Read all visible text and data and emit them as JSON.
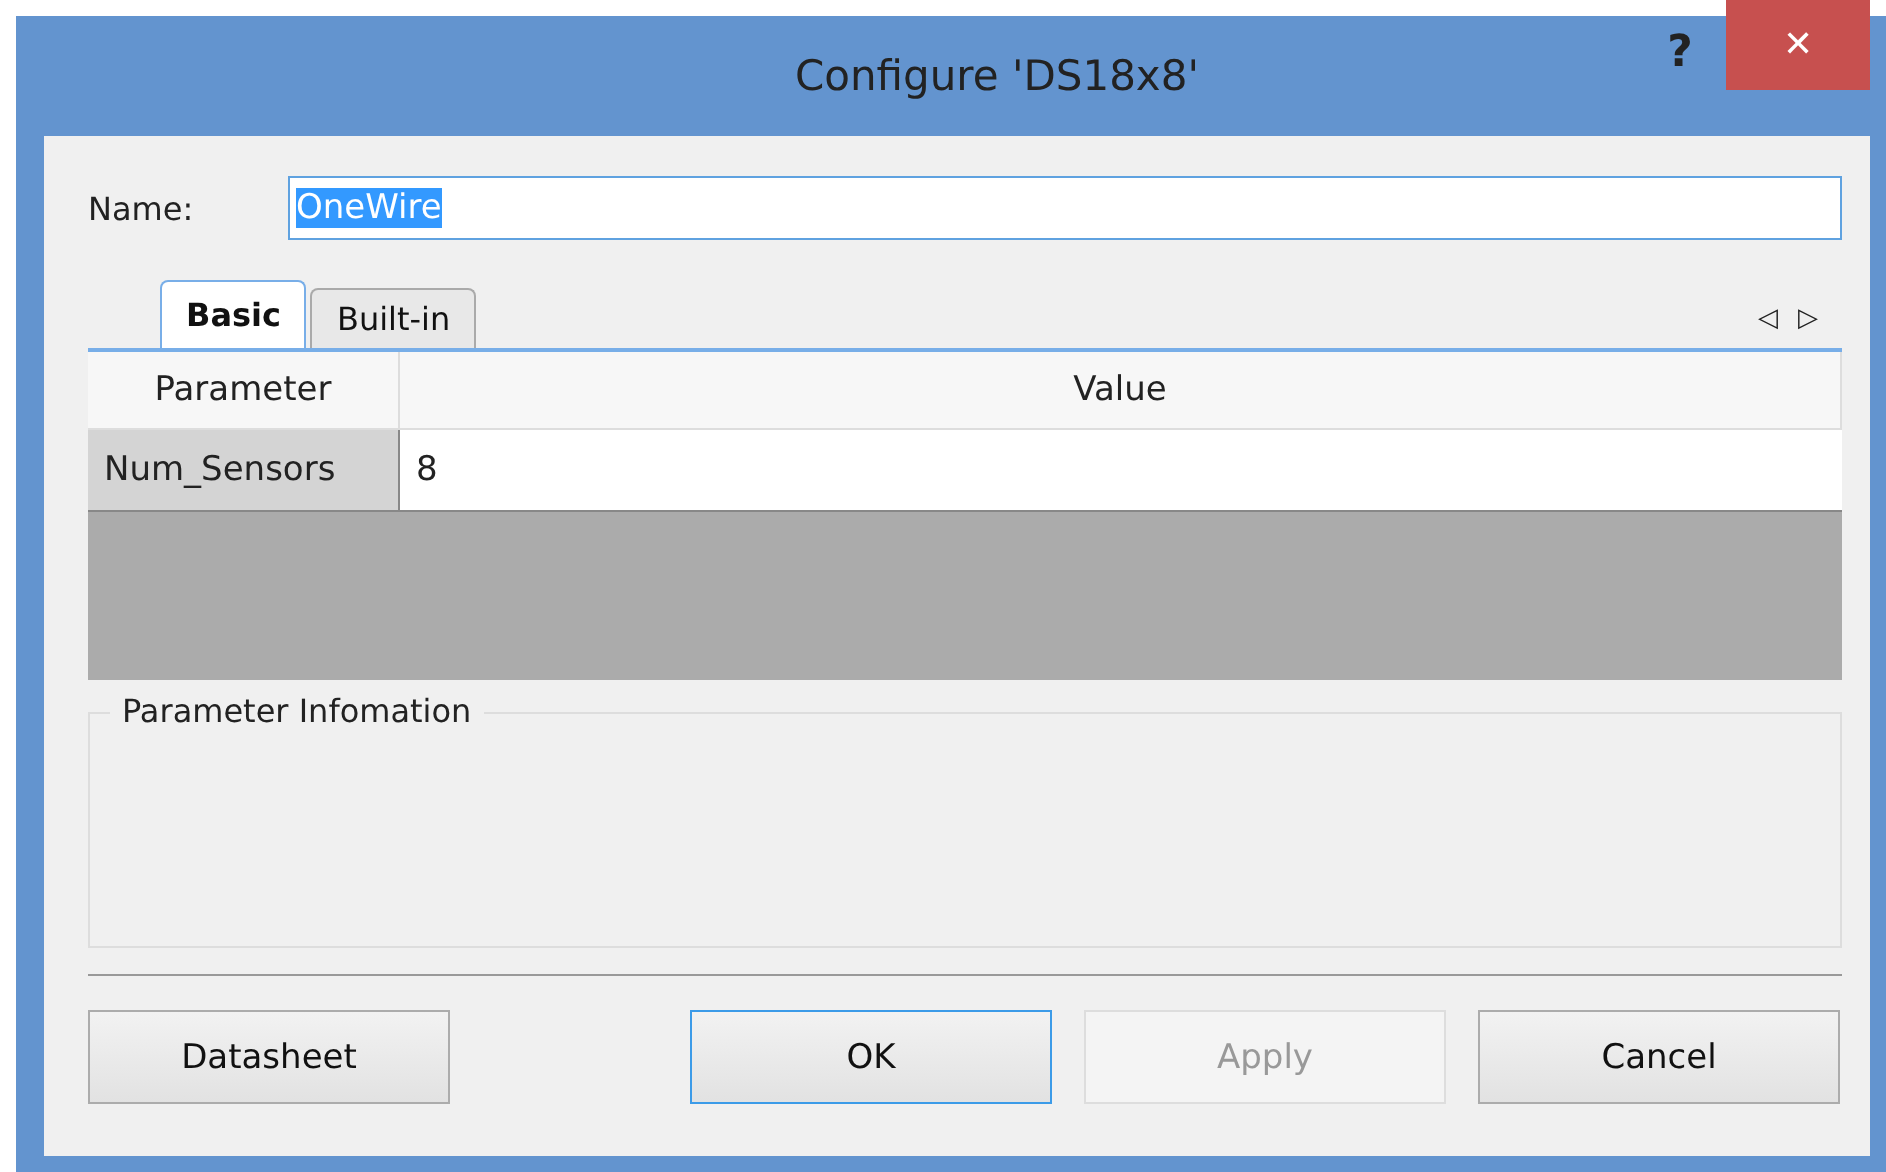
{
  "window": {
    "title": "Configure 'DS18x8'",
    "help": "?",
    "close": "✕"
  },
  "name_field": {
    "label": "Name:",
    "value": "OneWire",
    "selected": true
  },
  "tabs": [
    {
      "label": "Basic",
      "selected": true
    },
    {
      "label": "Built-in",
      "selected": false
    }
  ],
  "tab_scroll": [
    "◁",
    "▷"
  ],
  "table": {
    "columns": [
      "Parameter",
      "Value"
    ],
    "rows": [
      {
        "cells": [
          "Num_Sensors",
          "8"
        ]
      }
    ]
  },
  "info_group": {
    "title": "Parameter Infomation"
  },
  "buttons": [
    {
      "label": "Datasheet",
      "focused": false,
      "disabled": false
    },
    {
      "label": "OK",
      "focused": true,
      "disabled": false
    },
    {
      "label": "Apply",
      "focused": false,
      "disabled": true
    },
    {
      "label": "Cancel",
      "focused": false,
      "disabled": false
    }
  ]
}
